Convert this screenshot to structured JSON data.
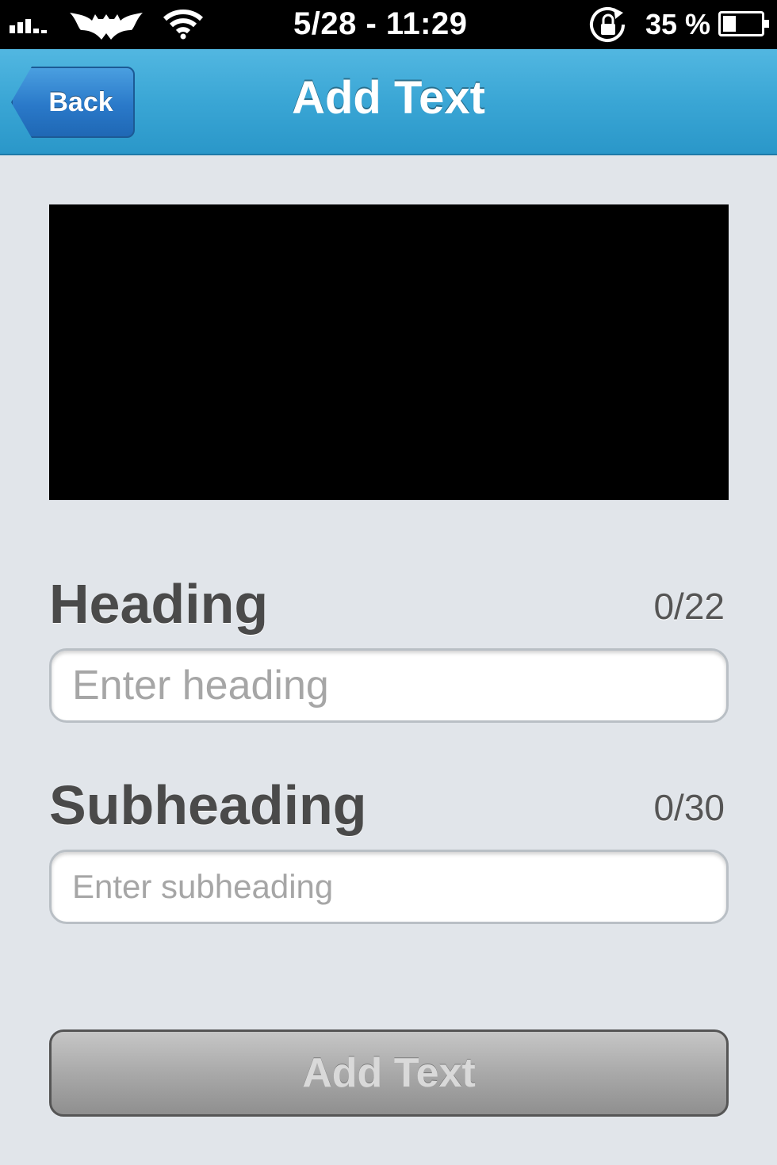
{
  "status_bar": {
    "time": "5/28 - 11:29",
    "battery_percent_label": "35 %",
    "battery_level": 0.35,
    "icons": [
      "signal-icon",
      "carrier-logo-icon",
      "wifi-icon",
      "rotation-lock-icon",
      "battery-icon"
    ]
  },
  "nav": {
    "back_label": "Back",
    "title": "Add Text"
  },
  "form": {
    "heading": {
      "label": "Heading",
      "counter": "0/22",
      "placeholder": "Enter heading",
      "value": ""
    },
    "subheading": {
      "label": "Subheading",
      "counter": "0/30",
      "placeholder": "Enter subheading",
      "value": ""
    },
    "submit_label": "Add Text"
  },
  "colors": {
    "nav_bar": "#3aa6d5",
    "back_button": "#2a79c9",
    "background": "#e1e5ea",
    "preview": "#000000",
    "button_disabled": "#a9a9a9"
  }
}
